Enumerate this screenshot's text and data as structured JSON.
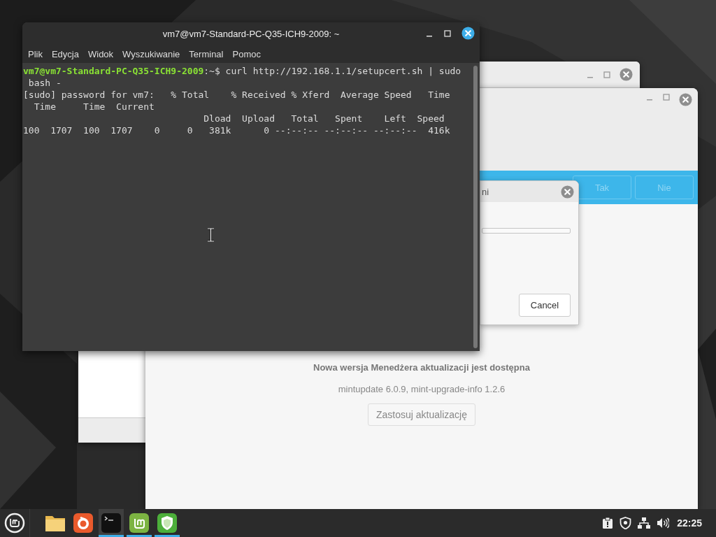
{
  "terminal": {
    "title": "vm7@vm7-Standard-PC-Q35-ICH9-2009: ~",
    "menu": [
      "Plik",
      "Edycja",
      "Widok",
      "Wyszukiwanie",
      "Terminal",
      "Pomoc"
    ],
    "prompt": {
      "user_host": "vm7@vm7-Standard-PC-Q35-ICH9-2009",
      "path": ":~$",
      "command": " curl http://192.168.1.1/setupcert.sh | sudo"
    },
    "lines": [
      " bash -",
      "[sudo] password for vm7:   % Total    % Received % Xferd  Average Speed   Time",
      "  Time     Time  Current",
      "                                 Dload  Upload   Total   Spent    Left  Speed",
      "100  1707  100  1707    0     0   381k      0 --:--:-- --:--:-- --:--:--  416k"
    ]
  },
  "update_manager": {
    "banner_buttons": [
      "Tak",
      "Nie"
    ],
    "message": "Nowa wersja Menedżera aktualizacji jest dostępna",
    "version": "mintupdate 6.0.9, mint-upgrade-info 1.2.6",
    "apply_button": "Zastosuj aktualizację"
  },
  "progress_dialog": {
    "title": "ni",
    "level": 0,
    "cancel_button": "Cancel"
  },
  "taskbar": {
    "items": [
      {
        "kind": "folder",
        "running": false,
        "selected": false
      },
      {
        "kind": "browser",
        "running": false,
        "selected": false
      },
      {
        "kind": "terminal",
        "running": true,
        "selected": true
      },
      {
        "kind": "mintupdate",
        "running": true,
        "selected": false
      },
      {
        "kind": "shield",
        "running": true,
        "selected": false
      }
    ],
    "tray": [
      {
        "kind": "clipboard"
      },
      {
        "kind": "shield"
      },
      {
        "kind": "network"
      },
      {
        "kind": "volume"
      }
    ],
    "clock": "22:25"
  }
}
